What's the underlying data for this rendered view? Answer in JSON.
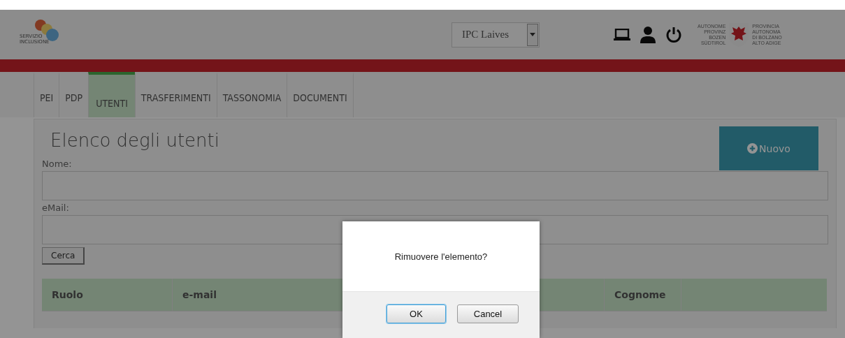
{
  "header": {
    "logo_text": [
      "SERVIZIO",
      "INCLUSIONE"
    ],
    "school_select": {
      "value": "IPC Laives"
    },
    "province_left": [
      "AUTONOME",
      "PROVINZ",
      "BOZEN",
      "SÜDTIROL"
    ],
    "province_right": [
      "PROVINCIA",
      "AUTONOMA",
      "DI BOLZANO",
      "ALTO ADIGE"
    ]
  },
  "tabs": [
    {
      "label": "PEI",
      "selected": false
    },
    {
      "label": "PDP",
      "selected": false
    },
    {
      "label": "UTENTI",
      "selected": true
    },
    {
      "label": "TRASFERIMENTI",
      "selected": false
    },
    {
      "label": "TASSONOMIA",
      "selected": false
    },
    {
      "label": "DOCUMENTI",
      "selected": false
    }
  ],
  "panel": {
    "title": "Elenco degli utenti",
    "new_button": "Nuovo",
    "fields": [
      {
        "label": "Nome:"
      },
      {
        "label": "eMail:"
      }
    ],
    "search_button": "Cerca"
  },
  "table": {
    "columns": [
      "Ruolo",
      "e-mail",
      "Cognome"
    ]
  },
  "dialog": {
    "message": "Rimuovere l'elemento?",
    "buttons": [
      {
        "label": "OK",
        "focused": true
      },
      {
        "label": "Cancel",
        "focused": false
      }
    ]
  }
}
